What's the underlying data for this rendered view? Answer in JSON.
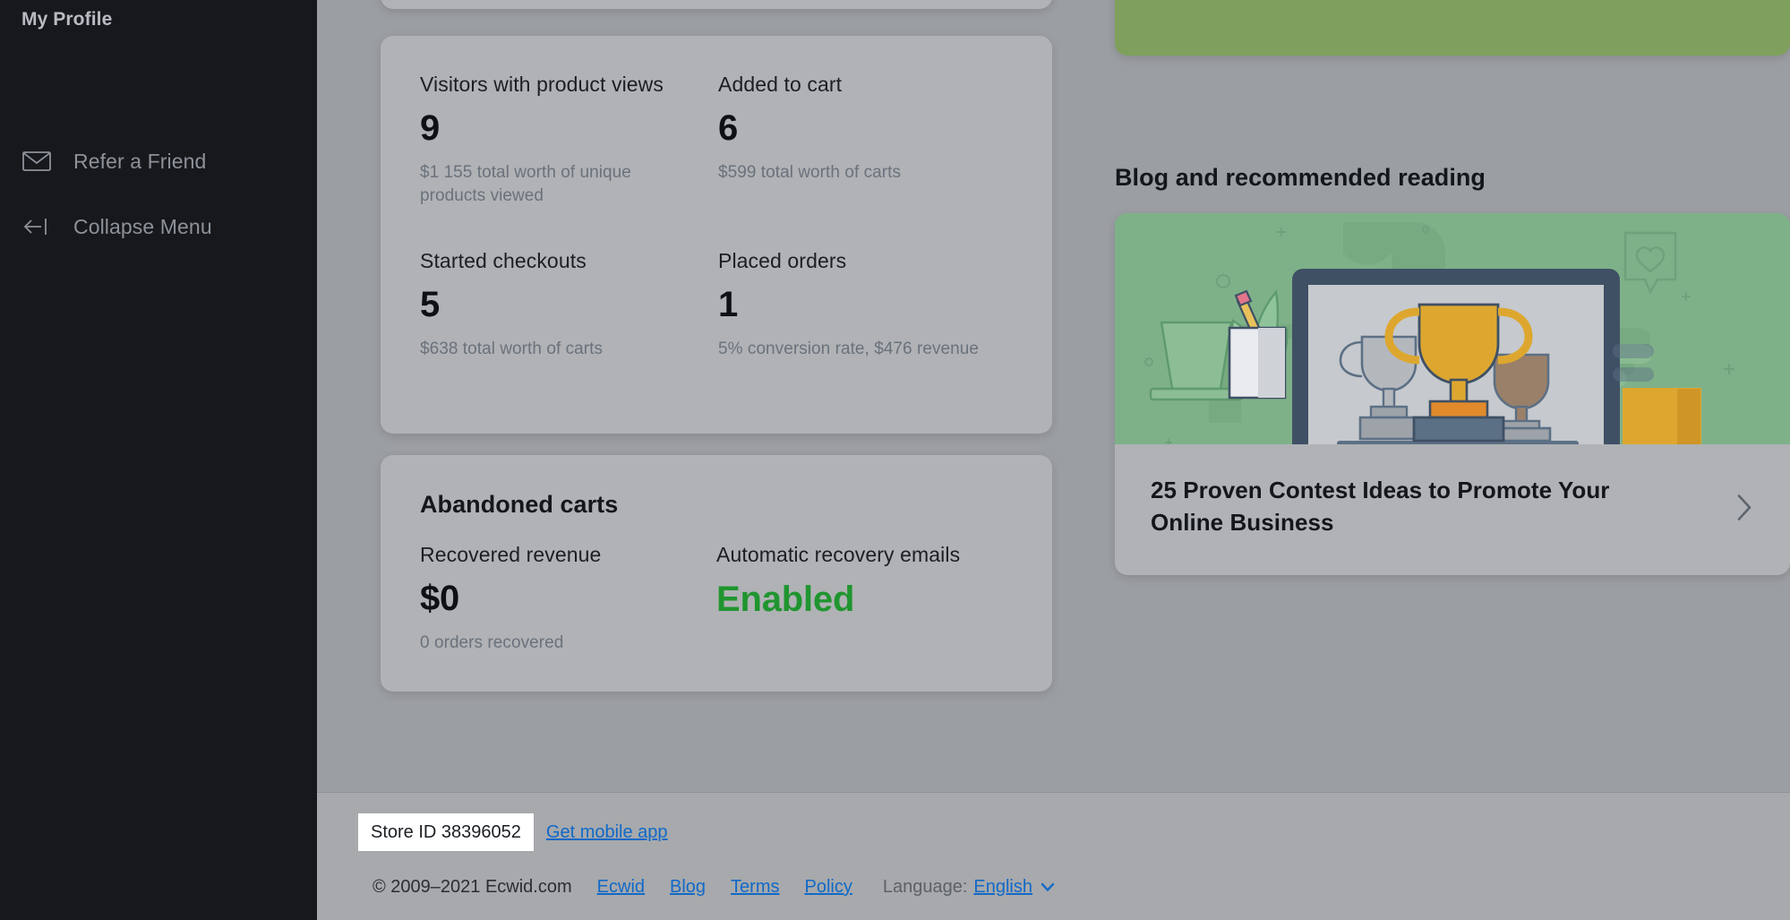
{
  "sidebar": {
    "title": "My Profile",
    "items": [
      {
        "label": "Refer a Friend",
        "icon": "envelope-icon"
      },
      {
        "label": "Collapse Menu",
        "icon": "arrow-left-bar-icon"
      }
    ]
  },
  "stats": {
    "blocks": [
      {
        "label": "Visitors with product views",
        "value": "9",
        "sub": "$1 155 total worth of unique products viewed"
      },
      {
        "label": "Added to cart",
        "value": "6",
        "sub": "$599 total worth of carts"
      },
      {
        "label": "Started checkouts",
        "value": "5",
        "sub": "$638 total worth of carts"
      },
      {
        "label": "Placed orders",
        "value": "1",
        "sub": "5% conversion rate, $476 revenue"
      }
    ]
  },
  "abandoned_carts": {
    "title": "Abandoned carts",
    "recovered_label": "Recovered revenue",
    "recovered_value": "$0",
    "recovered_sub": "0 orders recovered",
    "emails_label": "Automatic recovery emails",
    "emails_value": "Enabled",
    "enabled_color": "#20952f"
  },
  "blog": {
    "heading": "Blog and recommended reading",
    "article_title": "25 Proven Contest Ideas to Promote Your Online Business",
    "chevron": "chevron-right-icon",
    "hero_bg": "#7fb189"
  },
  "footer": {
    "store_id": "Store ID 38396052",
    "get_mobile_app": "Get mobile app",
    "copyright": "© 2009–2021 Ecwid.com",
    "links": [
      "Ecwid",
      "Blog",
      "Terms",
      "Policy"
    ],
    "language_label": "Language:",
    "language_value": "English",
    "link_color": "#1169c7"
  }
}
